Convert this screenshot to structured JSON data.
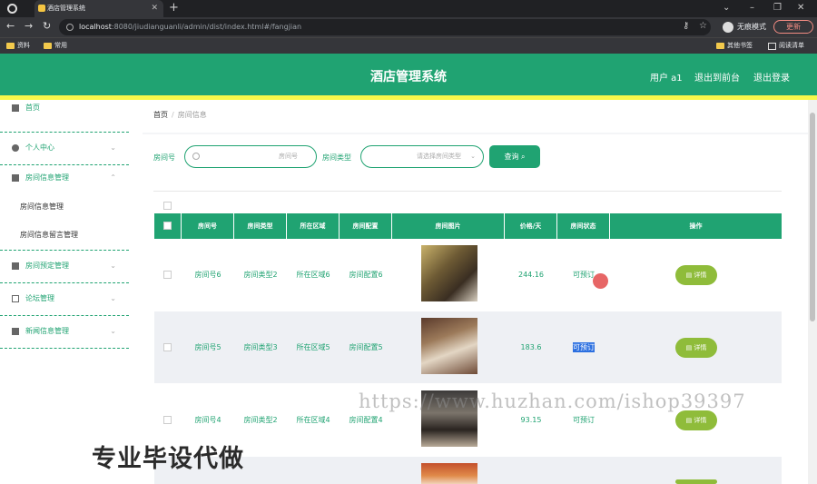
{
  "browser": {
    "tab_title": "酒店管理系统",
    "url_host": "localhost",
    "url_rest": ":8080/jiudianguanli/admin/dist/index.html#/fangjian",
    "incognito_label": "无痕模式",
    "update_label": "更新",
    "bookmarks": [
      "资料",
      "常用"
    ],
    "bookmarks_right": [
      "其他书签",
      "阅读清单"
    ]
  },
  "header": {
    "title": "酒店管理系统",
    "user_label": "用户 a1",
    "front_label": "退出到前台",
    "logout_label": "退出登录",
    "accent": "#20a372",
    "stripe": "#f7f74a"
  },
  "sidebar": {
    "items": [
      {
        "label": "首页",
        "icon": "home-icon"
      },
      {
        "label": "个人中心",
        "icon": "user-icon"
      },
      {
        "label": "房间信息管理",
        "icon": "grid-icon"
      },
      {
        "label": "房间预定管理",
        "icon": "calendar-icon"
      },
      {
        "label": "论坛管理",
        "icon": "chat-icon"
      },
      {
        "label": "新闻信息管理",
        "icon": "news-icon"
      }
    ],
    "subitems": [
      "房间信息管理",
      "房间信息留言管理"
    ]
  },
  "breadcrumb": {
    "home": "首页",
    "current": "房间信息"
  },
  "search": {
    "room_no_label": "房间号",
    "room_no_placeholder": "房间号",
    "room_type_label": "房间类型",
    "room_type_placeholder": "请选择房间类型",
    "query_label": "查询"
  },
  "table": {
    "headers": [
      "房间号",
      "房间类型",
      "所在区域",
      "房间配置",
      "房间图片",
      "价格/天",
      "房间状态",
      "操作"
    ],
    "rows": [
      {
        "room_no": "房间号6",
        "type": "房间类型2",
        "area": "所在区域6",
        "config": "房间配置6",
        "price": "244.16",
        "status": "可预订",
        "action": "详情"
      },
      {
        "room_no": "房间号5",
        "type": "房间类型3",
        "area": "所在区域5",
        "config": "房间配置5",
        "price": "183.6",
        "status": "可预订",
        "action": "详情"
      },
      {
        "room_no": "房间号4",
        "type": "房间类型2",
        "area": "所在区域4",
        "config": "房间配置4",
        "price": "93.15",
        "status": "可预订",
        "action": "详情"
      }
    ]
  },
  "watermark": "https://www.huzhan.com/ishop39397",
  "overlay_text": "专业毕设代做"
}
